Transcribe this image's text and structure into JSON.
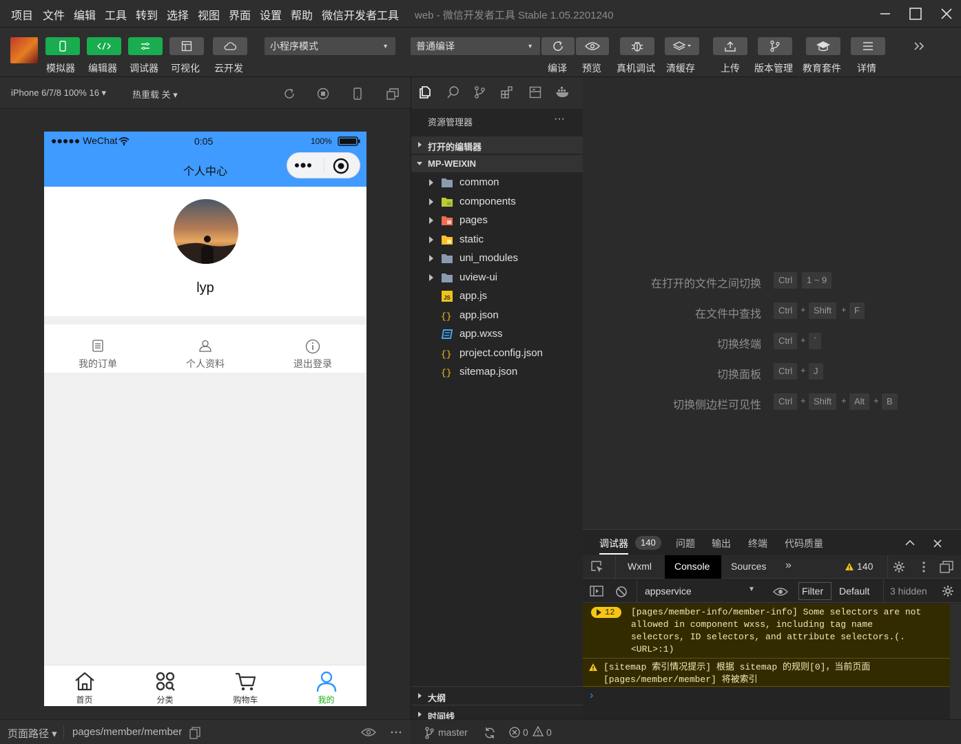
{
  "menubar": {
    "items": [
      "项目",
      "文件",
      "编辑",
      "工具",
      "转到",
      "选择",
      "视图",
      "界面",
      "设置",
      "帮助",
      "微信开发者工具"
    ],
    "window_title": "web - 微信开发者工具 Stable 1.05.2201240"
  },
  "toolbar": {
    "left_buttons": [
      {
        "label": "模拟器",
        "icon": "phone-icon"
      },
      {
        "label": "编辑器",
        "icon": "code-icon"
      },
      {
        "label": "调试器",
        "icon": "debug-toggle-icon"
      },
      {
        "label": "可视化",
        "icon": "layout-icon"
      },
      {
        "label": "云开发",
        "icon": "cloud-icon"
      }
    ],
    "mode_select": "小程序模式",
    "compile_select": "普通编译",
    "right_buttons": [
      {
        "label": "编译",
        "icon": "refresh-icon"
      },
      {
        "label": "预览",
        "icon": "eye-icon"
      },
      {
        "label": "真机调试",
        "icon": "bug-icon"
      },
      {
        "label": "清缓存",
        "icon": "layers-icon"
      },
      {
        "label": "上传",
        "icon": "upload-icon"
      },
      {
        "label": "版本管理",
        "icon": "branch-icon"
      },
      {
        "label": "教育套件",
        "icon": "graduation-cap-icon"
      },
      {
        "label": "详情",
        "icon": "menu-lines-icon"
      }
    ]
  },
  "simulator": {
    "device": "iPhone 6/7/8 100% 16 ▾",
    "hot_reload": "热重载 关 ▾",
    "status_carrier": "●●●●● WeChat",
    "status_time": "0:05",
    "status_battery": "100%",
    "nav_title": "个人中心",
    "username": "lyp",
    "menu": [
      "我的订单",
      "个人资料",
      "退出登录"
    ],
    "tabs": [
      {
        "label": "首页",
        "icon": "home-icon"
      },
      {
        "label": "分类",
        "icon": "category-icon"
      },
      {
        "label": "购物车",
        "icon": "cart-icon"
      },
      {
        "label": "我的",
        "icon": "user-icon"
      }
    ],
    "active_tab_color": "#1aad19"
  },
  "bottom_left": {
    "path_label": "页面路径 ▾",
    "path": "pages/member/member"
  },
  "explorer": {
    "title": "资源管理器",
    "more": "···",
    "open_editors": "打开的编辑器",
    "project": "MP-WEIXIN",
    "tree": [
      {
        "name": "common",
        "type": "folder"
      },
      {
        "name": "components",
        "type": "folder"
      },
      {
        "name": "pages",
        "type": "folder"
      },
      {
        "name": "static",
        "type": "folder"
      },
      {
        "name": "uni_modules",
        "type": "folder"
      },
      {
        "name": "uview-ui",
        "type": "folder"
      },
      {
        "name": "app.js",
        "type": "js"
      },
      {
        "name": "app.json",
        "type": "json"
      },
      {
        "name": "app.wxss",
        "type": "css"
      },
      {
        "name": "project.config.json",
        "type": "json"
      },
      {
        "name": "sitemap.json",
        "type": "json"
      }
    ],
    "outline": "大纲",
    "timeline": "时间线"
  },
  "shortcuts": [
    {
      "label": "在打开的文件之间切换",
      "keys": [
        "Ctrl",
        "1 ~ 9"
      ]
    },
    {
      "label": "在文件中查找",
      "keys": [
        "Ctrl",
        "Shift",
        "F"
      ]
    },
    {
      "label": "切换终端",
      "keys": [
        "Ctrl",
        "`"
      ]
    },
    {
      "label": "切换面板",
      "keys": [
        "Ctrl",
        "J"
      ]
    },
    {
      "label": "切换侧边栏可见性",
      "keys": [
        "Ctrl",
        "Shift",
        "Alt",
        "B"
      ]
    }
  ],
  "devtools": {
    "tabs": [
      "调试器",
      "问题",
      "输出",
      "终端",
      "代码质量"
    ],
    "debugger_badge": "140",
    "subtabs": [
      "Wxml",
      "Console",
      "Sources",
      "»"
    ],
    "warn_count": "140",
    "context": "appservice",
    "filter": "Filter",
    "level": "Default",
    "hidden": "3 hidden",
    "messages": [
      {
        "count": "12",
        "text": "[pages/member-info/member-info] Some selectors are not allowed in component wxss, including tag name selectors, ID selectors, and attribute selectors.(.<URL>:1)"
      },
      {
        "count": "",
        "text": "[sitemap 索引情况提示] 根据 sitemap 的规则[0]，当前页面 [pages/member/member] 将被索引"
      }
    ],
    "prompt": "›"
  },
  "statusbar": {
    "branch": "master",
    "errors": "0",
    "warnings": "0"
  },
  "colors": {
    "accent_green": "#19ad4f",
    "nav_blue": "#3f9bff",
    "warn_bg": "#332b00",
    "warn_text": "#f2e6b3"
  }
}
